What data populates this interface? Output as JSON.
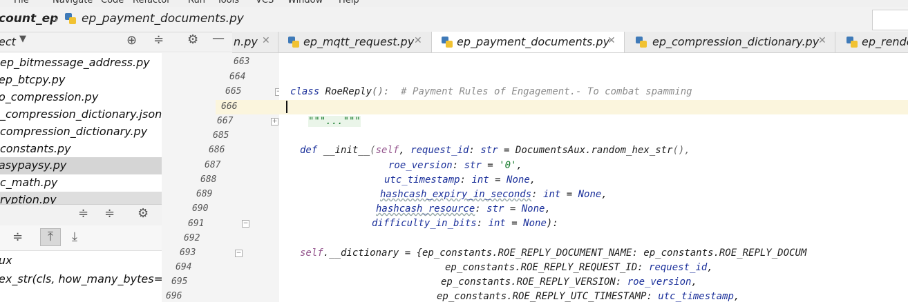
{
  "menu": {
    "items": [
      "File",
      "Navigate",
      "Code",
      "Refactor",
      "Run",
      "Tools",
      "VCS",
      "Window",
      "Help"
    ]
  },
  "nav": {
    "project": "count_ep",
    "file": "ep_payment_documents.py"
  },
  "project_panel": {
    "title": "ect",
    "files": [
      "ep_bitmessage_address.py",
      "ep_btcpy.py",
      "o_compression.py",
      "_compression_dictionary.json",
      "compression_dictionary.py",
      "constants.py",
      "asypaysy.py",
      "c_math.py",
      "ryption.py"
    ],
    "selected_index": 6
  },
  "structure_panel": {
    "items": [
      "ux",
      "ex_str(cls, how_many_bytes=ep_"
    ]
  },
  "tabs": [
    {
      "label": "n.py",
      "active": false
    },
    {
      "label": "ep_mqtt_request.py",
      "active": false
    },
    {
      "label": "ep_payment_documents.py",
      "active": true
    },
    {
      "label": "ep_compression_dictionary.py",
      "active": false
    },
    {
      "label": "ep_rende",
      "active": false
    }
  ],
  "editor": {
    "line_numbers": [
      "663",
      "664",
      "665",
      "666",
      "667",
      "685",
      "686",
      "687",
      "688",
      "689",
      "690",
      "691",
      "692",
      "693",
      "694",
      "695",
      "696"
    ],
    "current_line": "666",
    "code": {
      "l665_kw": "class",
      "l665_name": " RoeReply",
      "l665_paren": "():",
      "l665_comment": "  # Payment Rules of Engagement.- To combat spamming",
      "l667": "\"\"\"...\"\"\"",
      "l686_kw": "def",
      "l686_name": " __init__",
      "l686_open": "(",
      "l686_self": "self",
      "l686_a": ", ",
      "l686_p": "request_id",
      "l686_b": ": ",
      "l686_t": "str",
      "l686_c": " = DocumentsAux.",
      "l686_call": "random_hex_str",
      "l686_d": "(),",
      "l687_p": "roe_version",
      "l687_b": ": ",
      "l687_t": "str",
      "l687_c": " = ",
      "l687_v": "'0'",
      "l687_d": ",",
      "l688_p": "utc_timestamp",
      "l688_b": ": ",
      "l688_t": "int",
      "l688_c": " = ",
      "l688_v": "None",
      "l688_d": ",",
      "l689_p": "hashcash_expiry_in_seconds",
      "l689_b": ": ",
      "l689_t": "int",
      "l689_c": " = ",
      "l689_v": "None",
      "l689_d": ",",
      "l690_p": "hashcash_resource",
      "l690_b": ": ",
      "l690_t": "str",
      "l690_c": " = ",
      "l690_v": "None",
      "l690_d": ",",
      "l691_p": "difficulty_in_bits",
      "l691_b": ": ",
      "l691_t": "int",
      "l691_c": " = ",
      "l691_v": "None",
      "l691_d": "):",
      "l693_self": "self",
      "l693_a": ".__dictionary = {ep_constants.ROE_REPLY_DOCUMENT_NAME: ep_constants.ROE_REPLY_DOCUM",
      "l694_a": "ep_constants.ROE_REPLY_REQUEST_ID: ",
      "l694_p": "request_id",
      "l694_d": ",",
      "l695_a": "ep_constants.ROE_REPLY_VERSION: ",
      "l695_p": "roe_version",
      "l695_d": ",",
      "l696_a": "ep_constants.ROE_REPLY_UTC_TIMESTAMP: ",
      "l696_p": "utc_timestamp",
      "l696_d": ","
    }
  }
}
